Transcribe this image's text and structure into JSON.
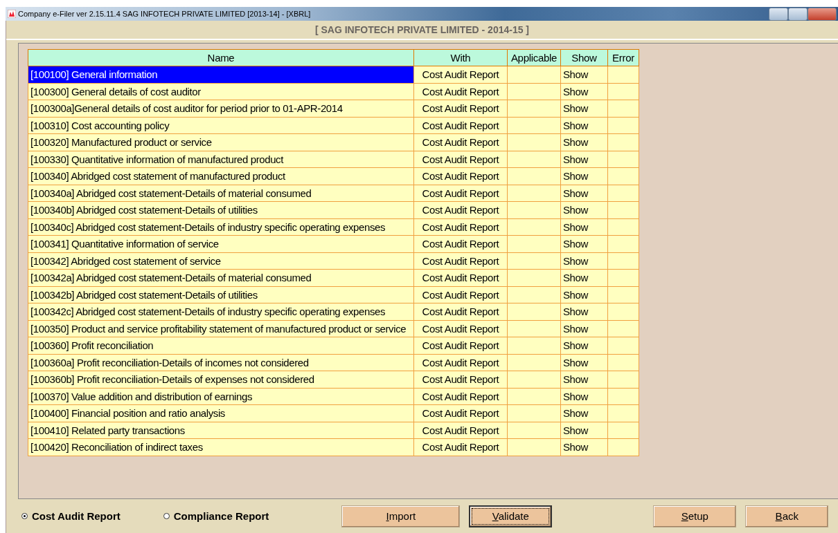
{
  "window": {
    "title": "Company e-Filer ver 2.15.11.4 SAG INFOTECH PRIVATE LIMITED [2013-14] - [XBRL]"
  },
  "header": "[ SAG INFOTECH PRIVATE LIMITED - 2014-15 ]",
  "table": {
    "columns": [
      "Name",
      "With",
      "Applicable",
      "Show",
      "Error"
    ],
    "rows": [
      {
        "name": "[100100] General information",
        "with": "Cost Audit Report",
        "show": "Show",
        "selected": true
      },
      {
        "name": "[100300] General details of cost auditor",
        "with": "Cost Audit Report",
        "show": "Show",
        "selected": false
      },
      {
        "name": "[100300a]General details of cost auditor for period prior to 01-APR-2014",
        "with": "Cost Audit Report",
        "show": "Show",
        "selected": false
      },
      {
        "name": "[100310] Cost accounting policy",
        "with": "Cost Audit Report",
        "show": "Show",
        "selected": false
      },
      {
        "name": "[100320] Manufactured product or service",
        "with": "Cost Audit Report",
        "show": "Show",
        "selected": false
      },
      {
        "name": "[100330] Quantitative information of manufactured product",
        "with": "Cost Audit Report",
        "show": "Show",
        "selected": false
      },
      {
        "name": "[100340] Abridged cost statement of manufactured product",
        "with": "Cost Audit Report",
        "show": "Show",
        "selected": false
      },
      {
        "name": "[100340a] Abridged cost statement-Details of material consumed",
        "with": "Cost Audit Report",
        "show": "Show",
        "selected": false
      },
      {
        "name": "[100340b] Abridged cost statement-Details of utilities",
        "with": "Cost Audit Report",
        "show": "Show",
        "selected": false
      },
      {
        "name": "[100340c] Abridged cost statement-Details of industry specific operating expenses",
        "with": "Cost Audit Report",
        "show": "Show",
        "selected": false
      },
      {
        "name": "[100341] Quantitative information of service",
        "with": "Cost Audit Report",
        "show": "Show",
        "selected": false
      },
      {
        "name": "[100342] Abridged cost statement of service",
        "with": "Cost Audit Report",
        "show": "Show",
        "selected": false
      },
      {
        "name": "[100342a] Abridged cost statement-Details of material consumed",
        "with": "Cost Audit Report",
        "show": "Show",
        "selected": false
      },
      {
        "name": "[100342b] Abridged cost statement-Details of utilities",
        "with": "Cost Audit Report",
        "show": "Show",
        "selected": false
      },
      {
        "name": "[100342c] Abridged cost statement-Details of industry specific operating expenses",
        "with": "Cost Audit Report",
        "show": "Show",
        "selected": false
      },
      {
        "name": "[100350] Product and service profitability statement of manufactured product or service",
        "with": "Cost Audit Report",
        "show": "Show",
        "selected": false
      },
      {
        "name": "[100360] Profit reconciliation",
        "with": "Cost Audit Report",
        "show": "Show",
        "selected": false
      },
      {
        "name": "[100360a] Profit reconciliation-Details of incomes not considered",
        "with": "Cost Audit Report",
        "show": "Show",
        "selected": false
      },
      {
        "name": "[100360b] Profit reconciliation-Details of expenses not considered",
        "with": "Cost Audit Report",
        "show": "Show",
        "selected": false
      },
      {
        "name": "[100370] Value addition and distribution of earnings",
        "with": "Cost Audit Report",
        "show": "Show",
        "selected": false
      },
      {
        "name": "[100400] Financial position and ratio analysis",
        "with": "Cost Audit Report",
        "show": "Show",
        "selected": false
      },
      {
        "name": "[100410] Related party transactions",
        "with": "Cost Audit Report",
        "show": "Show",
        "selected": false
      },
      {
        "name": "[100420] Reconciliation of indirect taxes",
        "with": "Cost Audit Report",
        "show": "Show",
        "selected": false
      }
    ]
  },
  "report_type": [
    {
      "label": "Cost Audit Report",
      "selected": true
    },
    {
      "label": "Compliance Report",
      "selected": false
    }
  ],
  "buttons": [
    {
      "label": "Import",
      "focused": false
    },
    {
      "label": "Validate",
      "focused": true
    },
    {
      "label": "Setup",
      "focused": false
    },
    {
      "label": "Back",
      "focused": false
    }
  ]
}
